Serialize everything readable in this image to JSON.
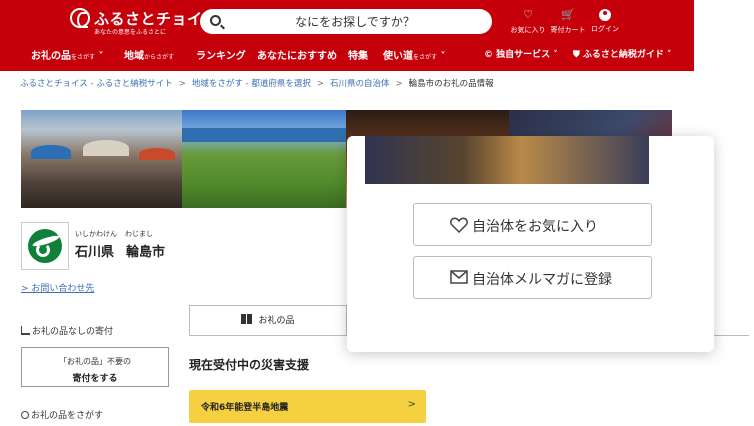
{
  "header": {
    "logo_text": "ふるさとチョイス",
    "logo_sub": "あなたの意思をふるさとに",
    "search_placeholder": "なにをお探しですか？",
    "favorites_label": "お気に入り",
    "cart_label": "寄付カート",
    "login_label": "ログイン",
    "nav": [
      {
        "label": "お礼の品",
        "suffix": "をさがす"
      },
      {
        "label": "地域",
        "suffix": "からさがす"
      },
      {
        "label": "ランキング",
        "suffix": ""
      },
      {
        "label": "あなたにおすすめ",
        "suffix": ""
      },
      {
        "label": "特集",
        "suffix": ""
      },
      {
        "label": "使い道",
        "suffix": "をさがす"
      }
    ],
    "service_label": "独自サービス",
    "guide_label": "ふるさと納税ガイド"
  },
  "breadcrumb": {
    "items": [
      "ふるさとチョイス - ふるさと納税サイト",
      "地域をさがす - 都道府県を選択",
      "石川県の自治体",
      "輪島市のお礼の品情報"
    ],
    "separator": ">"
  },
  "municipality": {
    "pref_reading": "いしかわけん",
    "city_reading": "わじまし",
    "pref": "石川県",
    "city": "輪島市",
    "contact_link": "> お問い合わせ先"
  },
  "sidebar": {
    "no_gift_heading": "お礼の品なしの寄付",
    "donate_line1": "「お礼の品」不要の",
    "donate_line2": "寄付をする",
    "search_heading": "お礼の品をさがす"
  },
  "tabs": {
    "gift_label": "お礼の品"
  },
  "disaster": {
    "title": "現在受付中の災害支援",
    "item_label": "令和6年能登半島地震",
    "chevron": ">"
  },
  "popup": {
    "favorite_label": "自治体をお気に入り",
    "newsletter_label": "自治体メルマガに登録"
  },
  "colors": {
    "brand_red": "#c5000b",
    "link_blue": "#3b6fb6",
    "disaster_yellow": "#f5d040"
  }
}
